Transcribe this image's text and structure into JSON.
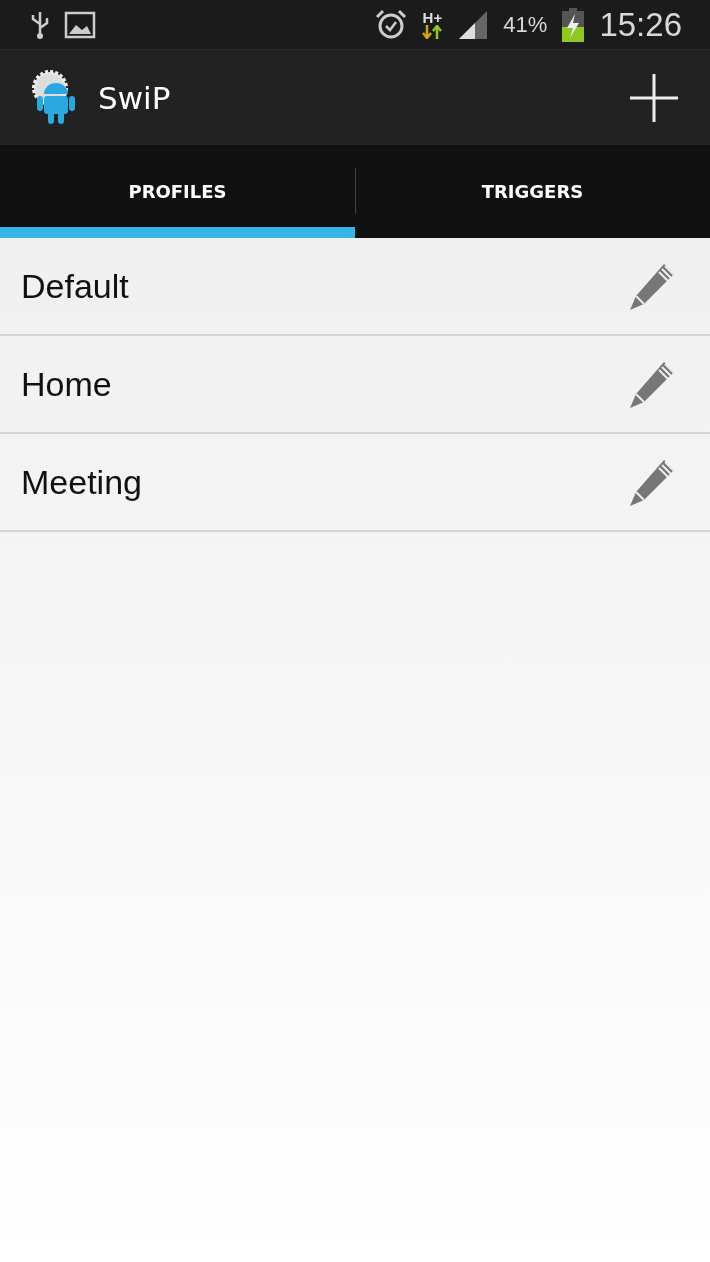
{
  "status_bar": {
    "network": "H+",
    "battery": "41%",
    "time": "15:26"
  },
  "app_bar": {
    "title": "SwiP"
  },
  "tabs": [
    {
      "label": "PROFILES",
      "selected": true
    },
    {
      "label": "TRIGGERS",
      "selected": false
    }
  ],
  "profiles": [
    {
      "name": "Default"
    },
    {
      "name": "Home"
    },
    {
      "name": "Meeting"
    }
  ]
}
